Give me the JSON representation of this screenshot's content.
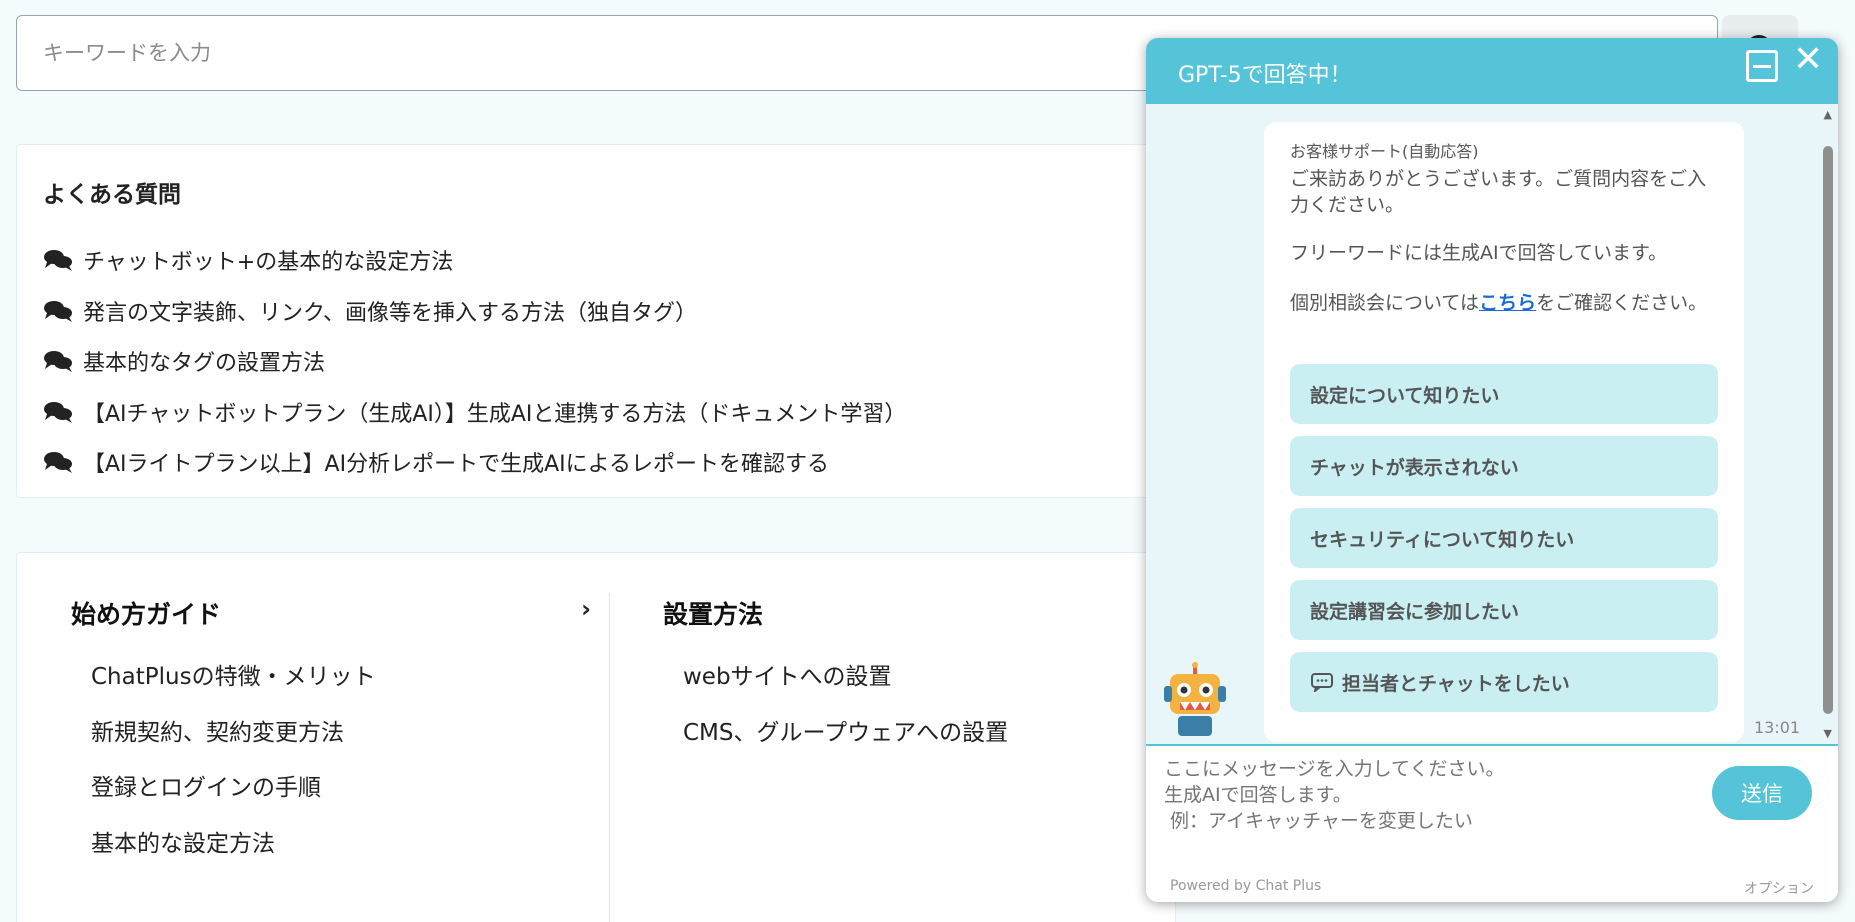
{
  "search": {
    "placeholder": "キーワードを入力",
    "button_icon": "search-icon"
  },
  "faq": {
    "title": "よくある質問",
    "items": [
      "チャットボット+の基本的な設定方法",
      "発言の文字装飾、リンク、画像等を挿入する方法（独自タグ）",
      "基本的なタグの設置方法",
      "【AIチャットボットプラン（生成AI）】生成AIと連携する方法（ドキュメント学習）",
      "【AIライトプラン以上】AI分析レポートで生成AIによるレポートを確認する"
    ]
  },
  "guides": [
    {
      "title": "始め方ガイド",
      "links": [
        "ChatPlusの特徴・メリット",
        "新規契約、契約変更方法",
        "登録とログインの手順",
        "基本的な設定方法"
      ]
    },
    {
      "title": "設置方法",
      "links": [
        "webサイトへの設置",
        "CMS、グループウェアへの設置"
      ]
    }
  ],
  "chat": {
    "header_title": "GPT-5で回答中！",
    "sender": "お客様サポート(自動応答)",
    "message_1": "ご来訪ありがとうございます。ご質問内容をご入力ください。",
    "message_2": "フリーワードには生成AIで回答しています。",
    "message_3_before": "個別相談会については",
    "message_3_link": "こちら",
    "message_3_after": "をご確認ください。",
    "quick_replies": [
      "設定について知りたい",
      "チャットが表示されない",
      "セキュリティについて知りたい",
      "設定講習会に参加したい",
      "担当者とチャットをしたい"
    ],
    "time": "13:01",
    "input_placeholder": "ここにメッセージを入力してください。\n生成AIで回答します。\n 例：アイキャッチャーを変更したい",
    "send_label": "送信",
    "powered_by": "Powered by Chat Plus",
    "options_label": "オプション"
  },
  "colors": {
    "accent": "#55c4d8",
    "quick_reply_bg": "#c9eff3",
    "chat_bg": "#e9f6f9",
    "link": "#1a6bd4"
  }
}
